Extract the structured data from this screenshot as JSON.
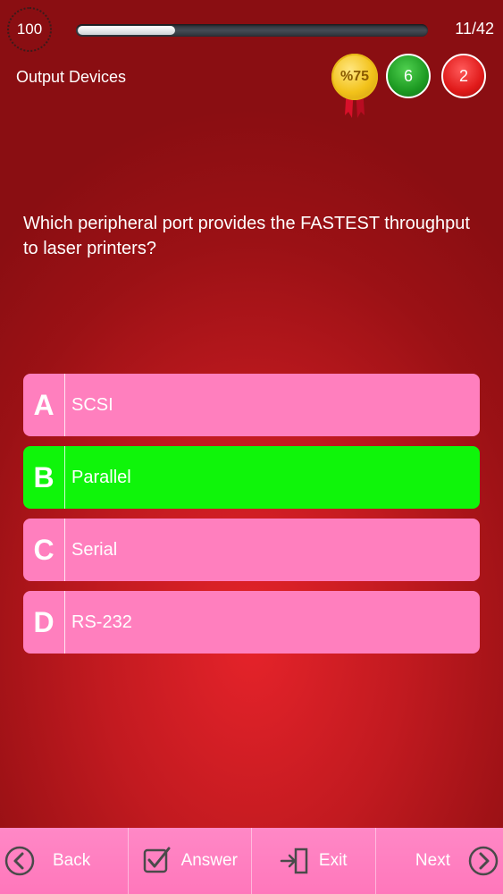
{
  "header": {
    "timer": "100",
    "progress_fraction": 0.28,
    "counter": "11/42",
    "category": "Output Devices",
    "medal_label": "%75",
    "correct_count": "6",
    "wrong_count": "2"
  },
  "question": {
    "text": "Which peripheral port provides the FASTEST throughput to laser printers?"
  },
  "options": [
    {
      "letter": "A",
      "text": "SCSI"
    },
    {
      "letter": "B",
      "text": "Parallel"
    },
    {
      "letter": "C",
      "text": "Serial"
    },
    {
      "letter": "D",
      "text": "RS-232"
    }
  ],
  "selected_option": "B",
  "nav": {
    "back": "Back",
    "answer": "Answer",
    "exit": "Exit",
    "next": "Next"
  },
  "icons": {
    "back": "chevron-left-circle-icon",
    "answer": "checkbox-icon",
    "exit": "exit-door-icon",
    "next": "chevron-right-circle-icon"
  },
  "colors": {
    "option": "#ff7fbe",
    "selected_option": "#0ff50a",
    "correct_badge": "#1d9a22",
    "wrong_badge": "#e01a1a",
    "medal": "#f2c21a"
  }
}
